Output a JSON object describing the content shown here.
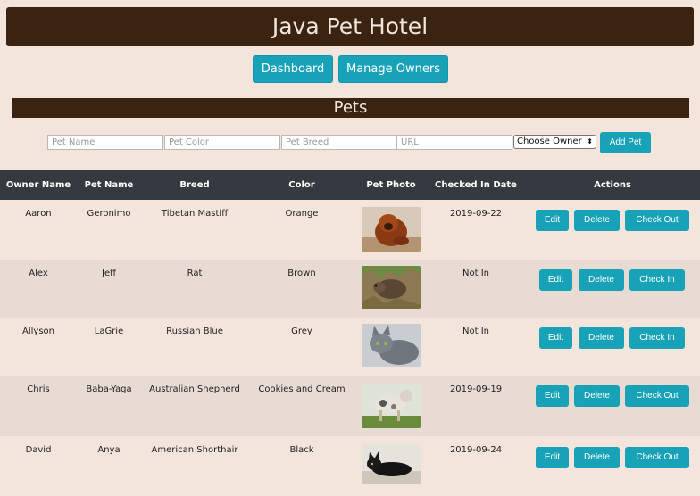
{
  "header": {
    "title": "Java Pet Hotel"
  },
  "nav": {
    "dashboard_label": "Dashboard",
    "owners_label": "Manage Owners"
  },
  "section": {
    "title": "Pets"
  },
  "form": {
    "pet_name_placeholder": "Pet Name",
    "pet_color_placeholder": "Pet Color",
    "pet_breed_placeholder": "Pet Breed",
    "url_placeholder": "URL",
    "owner_select_value": "Choose Owner",
    "add_label": "Add Pet"
  },
  "table": {
    "headers": [
      "Owner Name",
      "Pet Name",
      "Breed",
      "Color",
      "Pet Photo",
      "Checked In Date",
      "Actions"
    ],
    "rows": [
      {
        "owner": "Aaron",
        "pet": "Geronimo",
        "breed": "Tibetan Mastiff",
        "color": "Orange",
        "date": "2019-09-22",
        "edit": "Edit",
        "delete": "Delete",
        "toggle": "Check Out",
        "photo": "dog-photo"
      },
      {
        "owner": "Alex",
        "pet": "Jeff",
        "breed": "Rat",
        "color": "Brown",
        "date": "Not In",
        "edit": "Edit",
        "delete": "Delete",
        "toggle": "Check In",
        "photo": "rat-photo"
      },
      {
        "owner": "Allyson",
        "pet": "LaGrie",
        "breed": "Russian Blue",
        "color": "Grey",
        "date": "Not In",
        "edit": "Edit",
        "delete": "Delete",
        "toggle": "Check In",
        "photo": "cat-photo"
      },
      {
        "owner": "Chris",
        "pet": "Baba-Yaga",
        "breed": "Australian Shepherd",
        "color": "Cookies and Cream",
        "date": "2019-09-19",
        "edit": "Edit",
        "delete": "Delete",
        "toggle": "Check Out",
        "photo": "dog-photo"
      },
      {
        "owner": "David",
        "pet": "Anya",
        "breed": "American Shorthair",
        "color": "Black",
        "date": "2019-09-24",
        "edit": "Edit",
        "delete": "Delete",
        "toggle": "Check Out",
        "photo": "cat-photo"
      }
    ]
  },
  "colors": {
    "brand_dark": "#3a2411",
    "accent": "#17a2b8",
    "header_bg": "#343a40",
    "page_bg": "#f3e5db"
  }
}
